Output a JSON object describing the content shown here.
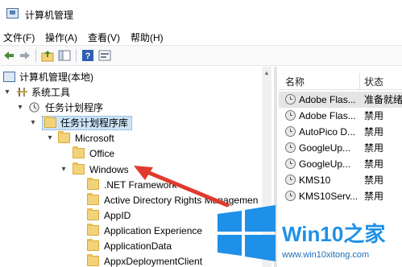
{
  "window": {
    "title": "计算机管理",
    "icon": "computer-management-icon"
  },
  "menu": [
    {
      "label": "文件(F)"
    },
    {
      "label": "操作(A)"
    },
    {
      "label": "查看(V)"
    },
    {
      "label": "帮助(H)"
    }
  ],
  "toolbar": {
    "icons": [
      "back-icon",
      "forward-icon",
      "up-folder-icon",
      "show-hide-tree-icon",
      "help-icon",
      "properties-icon"
    ]
  },
  "tree": {
    "items": [
      {
        "label": "计算机管理(本地)",
        "icon": "computer-management-icon",
        "expander": ""
      },
      {
        "label": "系统工具",
        "icon": "tools-icon",
        "expander": "▾"
      },
      {
        "label": "任务计划程序",
        "icon": "clock-icon",
        "expander": "▾"
      },
      {
        "label": "任务计划程序库",
        "icon": "folder-clock-icon",
        "expander": "▾"
      },
      {
        "label": "Microsoft",
        "icon": "folder-icon",
        "expander": "▾"
      },
      {
        "label": "Office",
        "icon": "folder-icon",
        "expander": ""
      },
      {
        "label": "Windows",
        "icon": "folder-icon",
        "expander": "▾"
      },
      {
        "label": ".NET Framework",
        "icon": "folder-icon",
        "expander": ""
      },
      {
        "label": "Active Directory Rights Managemen",
        "icon": "folder-icon",
        "expander": ""
      },
      {
        "label": "AppID",
        "icon": "folder-icon",
        "expander": ""
      },
      {
        "label": "Application Experience",
        "icon": "folder-icon",
        "expander": ""
      },
      {
        "label": "ApplicationData",
        "icon": "folder-icon",
        "expander": ""
      },
      {
        "label": "AppxDeploymentClient",
        "icon": "folder-icon",
        "expander": ""
      }
    ]
  },
  "list": {
    "columns": [
      "名称",
      "状态"
    ],
    "rows": [
      {
        "name": "Adobe Flas...",
        "status": "准备就绪"
      },
      {
        "name": "Adobe Flas...",
        "status": "禁用"
      },
      {
        "name": "AutoPico D...",
        "status": "禁用"
      },
      {
        "name": "GoogleUp...",
        "status": "禁用"
      },
      {
        "name": "GoogleUp...",
        "status": "禁用"
      },
      {
        "name": "KMS10",
        "status": "禁用"
      },
      {
        "name": "KMS10Serv...",
        "status": "禁用"
      }
    ]
  },
  "watermark": {
    "brand": "Win10之家",
    "url": "www.win10xitong.com"
  },
  "annotation": {
    "arrow_color": "#e03a2f"
  },
  "colors": {
    "win_blue": "#1e90e8",
    "folder": "#f3d37a",
    "selection": "#cce4f7"
  }
}
